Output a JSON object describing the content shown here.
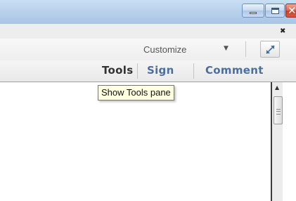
{
  "window": {
    "minimize_icon": "minimize-icon",
    "maximize_icon": "maximize-icon",
    "close_icon": "close-icon",
    "close_glyph": "✕"
  },
  "menubar": {
    "close_document_glyph": "✖"
  },
  "quick_tools": {
    "customize_label": "Customize",
    "customize_caret": "▼",
    "expand_icon": "expand-arrows-icon"
  },
  "pane_tabs": [
    {
      "label": "Tools"
    },
    {
      "label": "Sign"
    },
    {
      "label": "Comment"
    }
  ],
  "tooltip": {
    "text": "Show Tools pane"
  },
  "scrollbar": {
    "up_glyph": "▲"
  },
  "colors": {
    "titlebar": "#b6cfea",
    "close_button": "#d65a3f",
    "tab_active": "#333333",
    "tab_link": "#4a6fa0",
    "tooltip_bg": "#ffffe1"
  }
}
